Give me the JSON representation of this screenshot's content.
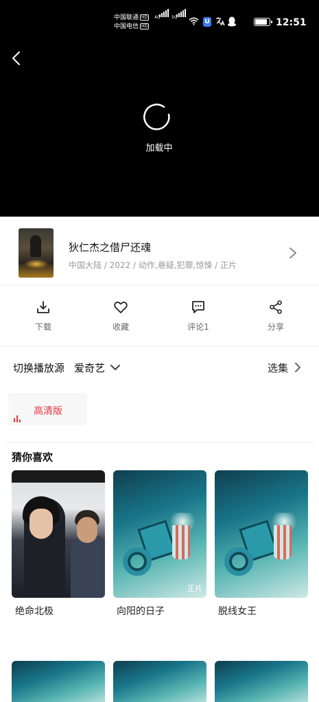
{
  "status_bar": {
    "carrier1": "中国联通",
    "carrier2": "中国电信",
    "hd": "HD",
    "net1": "4G",
    "net2": "5G",
    "time": "12:51",
    "app_badge": "U"
  },
  "player": {
    "loading_text": "加载中"
  },
  "movie": {
    "title": "狄仁杰之借尸还魂",
    "meta": "中国大陆 / 2022 / 动作,悬疑,犯罪,惊悚 / 正片"
  },
  "actions": [
    {
      "label": "下载",
      "icon": "download-icon"
    },
    {
      "label": "收藏",
      "icon": "heart-icon"
    },
    {
      "label": "评论1",
      "icon": "comment-icon"
    },
    {
      "label": "分享",
      "icon": "share-icon"
    }
  ],
  "source": {
    "label": "切换播放源",
    "value": "爱奇艺",
    "episodes": "选集"
  },
  "quality": {
    "label": "高清版"
  },
  "recommend": {
    "title": "猜你喜欢",
    "items": [
      {
        "title": "绝命北极",
        "badge": ""
      },
      {
        "title": "向阳的日子",
        "badge": "正片"
      },
      {
        "title": "脱线女王",
        "badge": ""
      }
    ]
  },
  "colors": {
    "accent_red": "#e8343a",
    "text_gray": "#999999"
  }
}
